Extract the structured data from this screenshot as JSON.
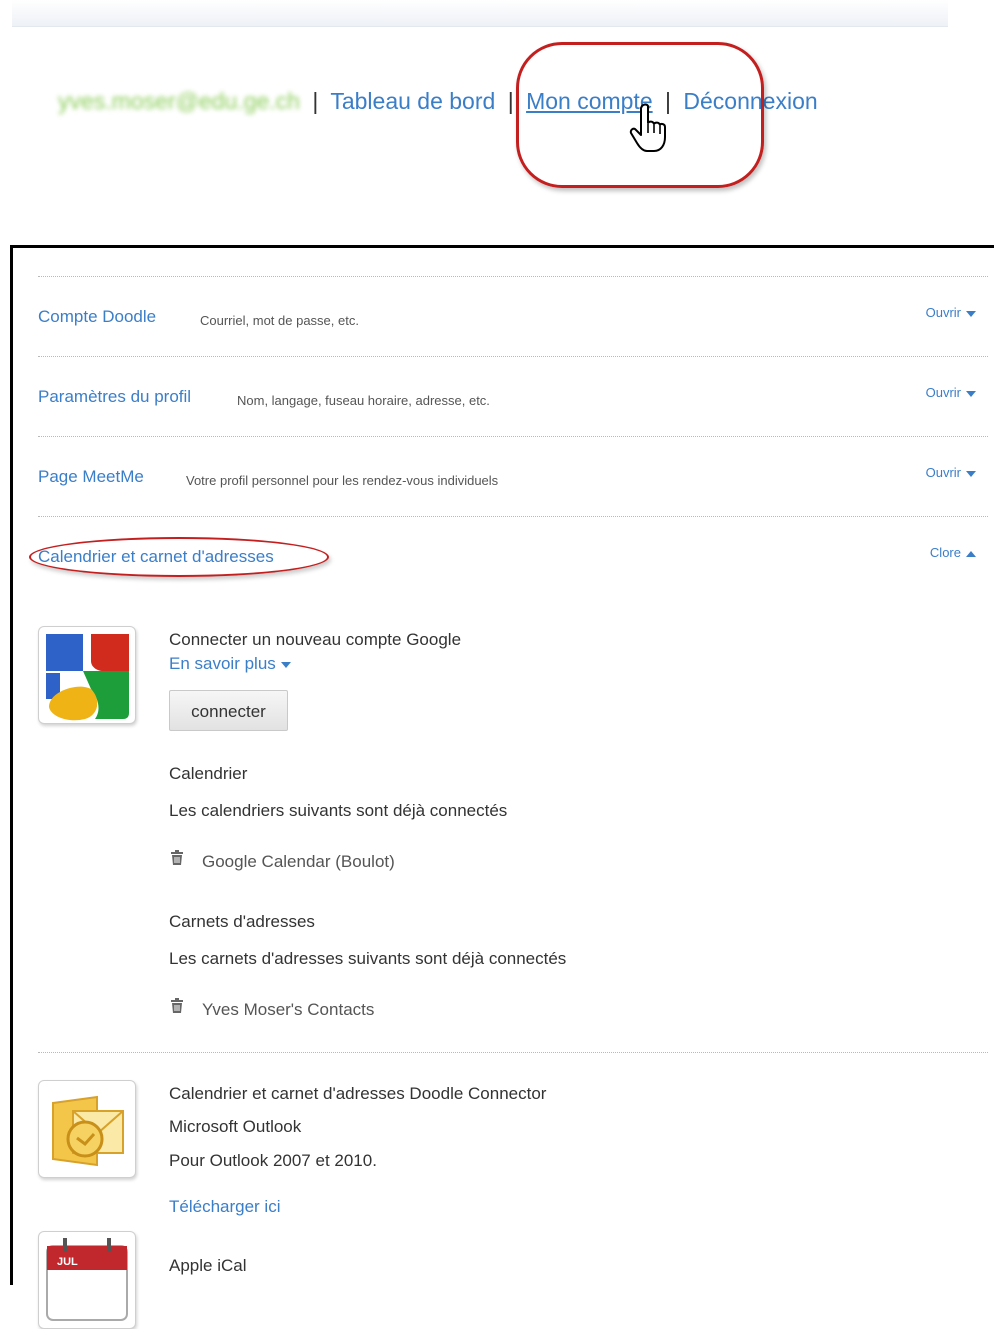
{
  "header": {
    "email": "yves.moser@edu.ge.ch",
    "separator": "|",
    "links": {
      "dashboard": "Tableau de bord",
      "account": "Mon compte",
      "logout": "Déconnexion"
    }
  },
  "sections": [
    {
      "title": "Compte Doodle",
      "description": "Courriel, mot de passe, etc.",
      "toggle": "Ouvrir",
      "state": "collapsed"
    },
    {
      "title": "Paramètres du profil",
      "description": "Nom, langage, fuseau horaire, adresse, etc.",
      "toggle": "Ouvrir",
      "state": "collapsed"
    },
    {
      "title": "Page MeetMe",
      "description": "Votre profil personnel pour les rendez-vous individuels",
      "toggle": "Ouvrir",
      "state": "collapsed"
    },
    {
      "title": "Calendrier et carnet d'adresses",
      "description": "",
      "toggle": "Clore",
      "state": "expanded"
    }
  ],
  "google": {
    "icon": "google-icon",
    "title": "Connecter un nouveau compte Google",
    "learn_more": "En savoir plus",
    "connect_button": "connecter",
    "calendar_heading": "Calendrier",
    "calendar_intro": "Les calendriers suivants sont déjà connectés",
    "calendars": [
      "Google Calendar (Boulot)"
    ],
    "addressbook_heading": "Carnets d'adresses",
    "addressbook_intro": "Les carnets d'adresses suivants sont déjà connectés",
    "addressbooks": [
      "Yves Moser's Contacts"
    ]
  },
  "outlook": {
    "icon": "outlook-icon",
    "title": "Calendrier et carnet d'adresses Doodle Connector",
    "product": "Microsoft Outlook",
    "versions": "Pour Outlook 2007 et 2010.",
    "download": "Télécharger ici"
  },
  "ical": {
    "icon": "ical-icon",
    "icon_text": "JUL",
    "title": "Apple iCal"
  },
  "colors": {
    "link": "#3b7ec8",
    "annotation_red": "#c41f1f",
    "text": "#333333",
    "muted": "#555555"
  }
}
